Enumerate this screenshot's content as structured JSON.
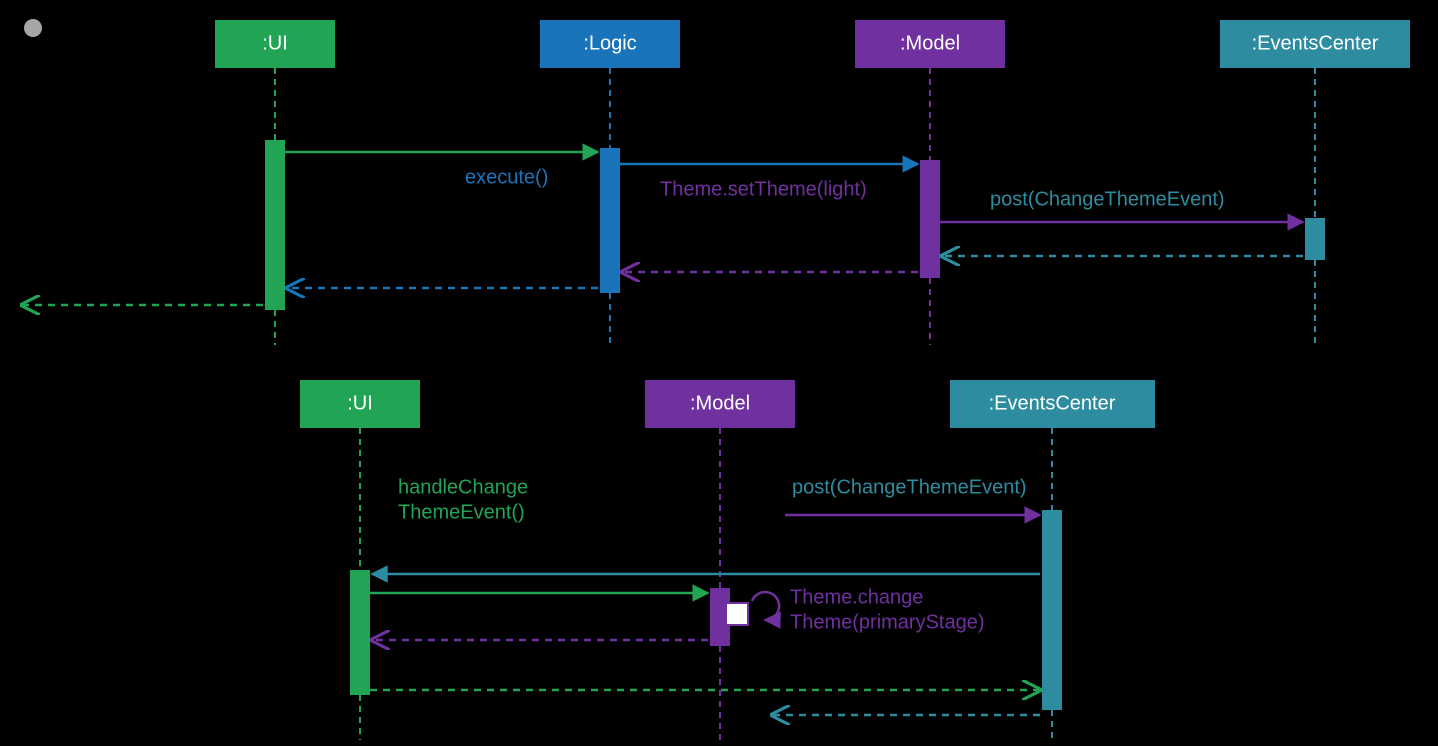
{
  "diagram1": {
    "participants": {
      "ui": {
        "label": ":UI",
        "color": "#21A555"
      },
      "logic": {
        "label": ":Logic",
        "color": "#1A74BA"
      },
      "model": {
        "label": ":Model",
        "color": "#7030A0"
      },
      "ec": {
        "label": ":EventsCenter",
        "color": "#2E8CA0"
      }
    },
    "messages": {
      "execute": {
        "text": "execute()",
        "color": "#1A74BA"
      },
      "setTheme": {
        "text": "Theme.setTheme(light)",
        "color": "#7030A0"
      },
      "postEvt": {
        "text": "post(ChangeThemeEvent)",
        "color": "#2E8CA0"
      }
    }
  },
  "diagram2": {
    "participants": {
      "ui": {
        "label": ":UI",
        "color": "#21A555"
      },
      "model": {
        "label": ":Model",
        "color": "#7030A0"
      },
      "ec": {
        "label": ":EventsCenter",
        "color": "#2E8CA0"
      }
    },
    "messages": {
      "postEvt": {
        "text": "post(ChangeThemeEvent)",
        "color": "#2E8CA0"
      },
      "handleEvt": {
        "line1": "handleChange",
        "line2": "ThemeEvent()",
        "color": "#21A555"
      },
      "changeThm": {
        "line1": "Theme.change",
        "line2": "Theme(primaryStage)",
        "color": "#7030A0"
      }
    }
  },
  "chart_data": [
    {
      "type": "sequence_diagram",
      "participants": [
        ":UI",
        ":Logic",
        ":Model",
        ":EventsCenter"
      ],
      "messages": [
        {
          "from": "found",
          "to": ":UI",
          "kind": "found",
          "label": ""
        },
        {
          "from": ":UI",
          "to": ":Logic",
          "kind": "sync",
          "label": "execute()"
        },
        {
          "from": ":Logic",
          "to": ":Model",
          "kind": "sync",
          "label": "Theme.setTheme(light)"
        },
        {
          "from": ":Model",
          "to": ":EventsCenter",
          "kind": "sync",
          "label": "post(ChangeThemeEvent)"
        },
        {
          "from": ":EventsCenter",
          "to": ":Model",
          "kind": "return",
          "label": ""
        },
        {
          "from": ":Model",
          "to": ":Logic",
          "kind": "return",
          "label": ""
        },
        {
          "from": ":Logic",
          "to": ":UI",
          "kind": "return",
          "label": ""
        },
        {
          "from": ":UI",
          "to": "found",
          "kind": "return",
          "label": ""
        }
      ]
    },
    {
      "type": "sequence_diagram",
      "participants": [
        ":UI",
        ":Model",
        ":EventsCenter"
      ],
      "messages": [
        {
          "from": ":Model",
          "to": ":EventsCenter",
          "kind": "sync",
          "label": "post(ChangeThemeEvent)"
        },
        {
          "from": ":EventsCenter",
          "to": ":UI",
          "kind": "sync",
          "label": "handleChangeThemeEvent()"
        },
        {
          "from": ":UI",
          "to": ":Model",
          "kind": "sync",
          "label": ""
        },
        {
          "from": ":Model",
          "to": ":Model",
          "kind": "self",
          "label": "Theme.changeTheme(primaryStage)"
        },
        {
          "from": ":Model",
          "to": ":UI",
          "kind": "return",
          "label": ""
        },
        {
          "from": ":UI",
          "to": ":EventsCenter",
          "kind": "return",
          "label": ""
        },
        {
          "from": ":EventsCenter",
          "to": ":Model",
          "kind": "return",
          "label": ""
        }
      ]
    }
  ]
}
